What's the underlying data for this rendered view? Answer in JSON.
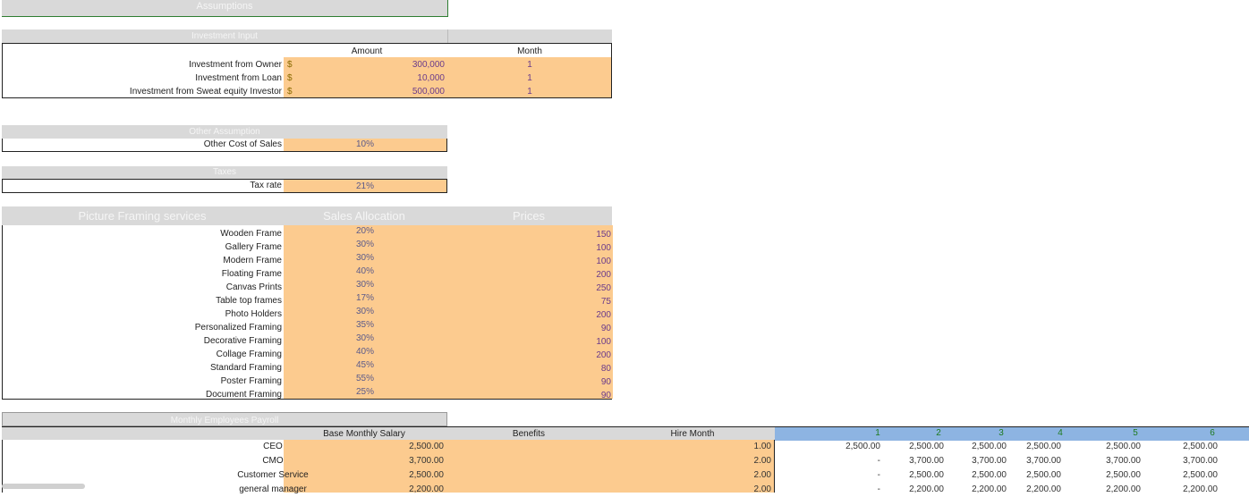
{
  "assumptions_title": "Assumptions",
  "investment": {
    "title": "Investment Input",
    "col_amount": "Amount",
    "col_month": "Month",
    "rows": [
      {
        "label": "Investment from Owner",
        "currency": "$",
        "amount": "300,000",
        "month": "1"
      },
      {
        "label": "Investment from Loan",
        "currency": "$",
        "amount": "10,000",
        "month": "1"
      },
      {
        "label": "Investment from Sweat equity Investor",
        "currency": "$",
        "amount": "500,000",
        "month": "1"
      }
    ]
  },
  "other": {
    "title": "Other Assumption",
    "label": "Other Cost of Sales",
    "value": "10%"
  },
  "taxes": {
    "title": "Taxes",
    "label": "Tax rate",
    "value": "21%"
  },
  "services": {
    "col_service": "Picture Framing services",
    "col_alloc": "Sales Allocation",
    "col_price": "Prices",
    "rows": [
      {
        "name": "Wooden Frame",
        "alloc": "20%",
        "price": "150"
      },
      {
        "name": "Gallery Frame",
        "alloc": "30%",
        "price": "100"
      },
      {
        "name": "Modern Frame",
        "alloc": "30%",
        "price": "100"
      },
      {
        "name": "Floating Frame",
        "alloc": "40%",
        "price": "200"
      },
      {
        "name": "Canvas Prints",
        "alloc": "30%",
        "price": "250"
      },
      {
        "name": "Table top frames",
        "alloc": "17%",
        "price": "75"
      },
      {
        "name": "Photo Holders",
        "alloc": "30%",
        "price": "200"
      },
      {
        "name": "Personalized Framing",
        "alloc": "35%",
        "price": "90"
      },
      {
        "name": "Decorative Framing",
        "alloc": "30%",
        "price": "100"
      },
      {
        "name": "Collage Framing",
        "alloc": "40%",
        "price": "200"
      },
      {
        "name": "Standard Framing",
        "alloc": "45%",
        "price": "80"
      },
      {
        "name": "Poster Framing",
        "alloc": "55%",
        "price": "90"
      },
      {
        "name": "Document Framing",
        "alloc": "25%",
        "price": "90"
      }
    ]
  },
  "payroll": {
    "title": "Monthly Employees Payroll",
    "col_salary": "Base Monthly Salary",
    "col_benefits": "Benefits",
    "col_hire": "Hire Month",
    "months": [
      "1",
      "2",
      "3",
      "4",
      "5",
      "6"
    ],
    "rows": [
      {
        "role": "CEO",
        "salary": "2,500.00",
        "hire": "1.00",
        "m": [
          "2,500.00",
          "2,500.00",
          "2,500.00",
          "2,500.00",
          "2,500.00",
          "2,500.00"
        ]
      },
      {
        "role": "CMO",
        "salary": "3,700.00",
        "hire": "2.00",
        "m": [
          "-",
          "3,700.00",
          "3,700.00",
          "3,700.00",
          "3,700.00",
          "3,700.00"
        ]
      },
      {
        "role": "Customer Service",
        "salary": "2,500.00",
        "hire": "2.00",
        "m": [
          "-",
          "2,500.00",
          "2,500.00",
          "2,500.00",
          "2,500.00",
          "2,500.00"
        ]
      },
      {
        "role": "general manager",
        "salary": "2,200.00",
        "hire": "2.00",
        "m": [
          "-",
          "2,200.00",
          "2,200.00",
          "2,200.00",
          "2,200.00",
          "2,200.00"
        ]
      }
    ]
  }
}
